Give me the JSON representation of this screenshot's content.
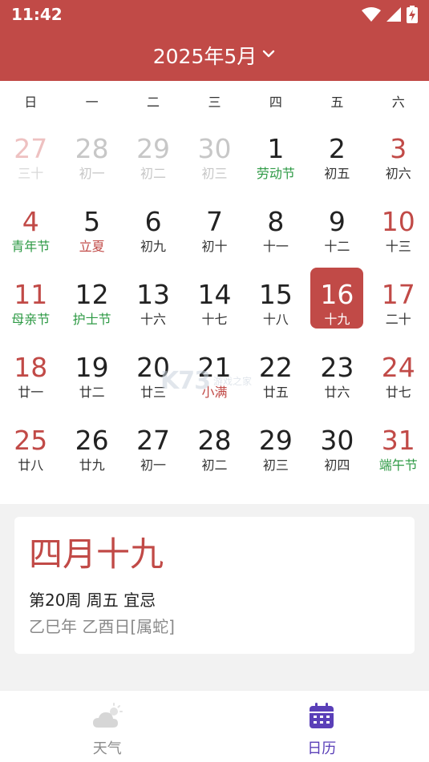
{
  "status_bar": {
    "time": "11:42"
  },
  "header": {
    "month_title": "2025年5月"
  },
  "weekdays": [
    "日",
    "一",
    "二",
    "三",
    "四",
    "五",
    "六"
  ],
  "days": [
    {
      "num": "27",
      "sub": "三十",
      "other": true,
      "weekend": true
    },
    {
      "num": "28",
      "sub": "初一",
      "other": true
    },
    {
      "num": "29",
      "sub": "初二",
      "other": true
    },
    {
      "num": "30",
      "sub": "初三",
      "other": true
    },
    {
      "num": "1",
      "sub": "劳动节",
      "festival": true
    },
    {
      "num": "2",
      "sub": "初五"
    },
    {
      "num": "3",
      "sub": "初六",
      "weekend": true
    },
    {
      "num": "4",
      "sub": "青年节",
      "festival": true,
      "weekend": true
    },
    {
      "num": "5",
      "sub": "立夏",
      "solar": true
    },
    {
      "num": "6",
      "sub": "初九"
    },
    {
      "num": "7",
      "sub": "初十"
    },
    {
      "num": "8",
      "sub": "十一"
    },
    {
      "num": "9",
      "sub": "十二"
    },
    {
      "num": "10",
      "sub": "十三",
      "weekend": true
    },
    {
      "num": "11",
      "sub": "母亲节",
      "festival": true,
      "weekend": true
    },
    {
      "num": "12",
      "sub": "护士节",
      "festival": true
    },
    {
      "num": "13",
      "sub": "十六"
    },
    {
      "num": "14",
      "sub": "十七"
    },
    {
      "num": "15",
      "sub": "十八"
    },
    {
      "num": "16",
      "sub": "十九",
      "selected": true
    },
    {
      "num": "17",
      "sub": "二十",
      "weekend": true
    },
    {
      "num": "18",
      "sub": "廿一",
      "weekend": true
    },
    {
      "num": "19",
      "sub": "廿二"
    },
    {
      "num": "20",
      "sub": "廿三"
    },
    {
      "num": "21",
      "sub": "小满",
      "solar": true
    },
    {
      "num": "22",
      "sub": "廿五"
    },
    {
      "num": "23",
      "sub": "廿六"
    },
    {
      "num": "24",
      "sub": "廿七",
      "weekend": true
    },
    {
      "num": "25",
      "sub": "廿八",
      "weekend": true
    },
    {
      "num": "26",
      "sub": "廿九"
    },
    {
      "num": "27",
      "sub": "初一"
    },
    {
      "num": "28",
      "sub": "初二"
    },
    {
      "num": "29",
      "sub": "初三"
    },
    {
      "num": "30",
      "sub": "初四"
    },
    {
      "num": "31",
      "sub": "端午节",
      "festival": true,
      "weekend": true
    }
  ],
  "info_card": {
    "lunar_date": "四月十九",
    "week_line": "第20周 周五 宜忌",
    "ganzhi_line": "乙巳年 乙酉日[属蛇]"
  },
  "bottom_nav": [
    {
      "label": "天气",
      "icon": "weather-cloud-icon",
      "active": false
    },
    {
      "label": "日历",
      "icon": "calendar-icon",
      "active": true
    }
  ],
  "watermark": {
    "brand": "K73",
    "text": "游戏之家"
  },
  "colors": {
    "primary": "#c14a47",
    "festival": "#2e9a45",
    "nav_active": "#5a3fb8",
    "nav_inactive": "#8a8a8a",
    "background_gray": "#f2f2f2"
  }
}
